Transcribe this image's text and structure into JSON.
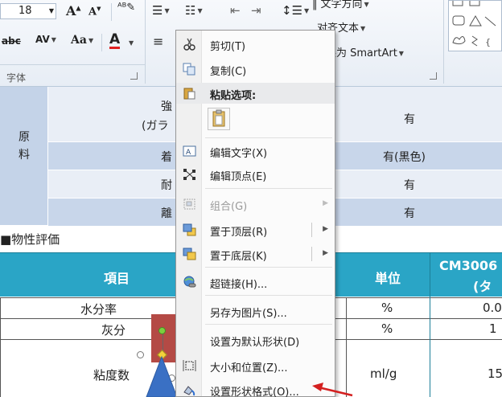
{
  "ribbon": {
    "font_size": "18",
    "group_font_label": "字体",
    "text_direction_label": "文字方向",
    "align_text_label": "对齐文本",
    "convert_smartart_label": "转换为 SmartArt"
  },
  "table1": {
    "row_header": [
      "原",
      "料"
    ],
    "rows": [
      {
        "item": "強",
        "item2": "(ガラ",
        "value": "有"
      },
      {
        "item": "着",
        "value": "有(黒色)"
      },
      {
        "item": "耐",
        "value": "有"
      },
      {
        "item": "離",
        "value": "有"
      }
    ]
  },
  "section_heading": "■物性評価",
  "table2": {
    "headers": {
      "item": "項目",
      "unit": "単位",
      "product": "CM3006",
      "product2": "(タ"
    },
    "rows": [
      {
        "item": "水分率",
        "unit": "%",
        "value": "0.0"
      },
      {
        "item": "灰分",
        "unit": "%",
        "value": "1"
      },
      {
        "item": "粘度数",
        "unit": "ml/g",
        "value": "15"
      }
    ]
  },
  "context_menu": {
    "items": [
      {
        "label": "剪切(T)",
        "icon": "scissors-icon"
      },
      {
        "label": "复制(C)",
        "icon": "copy-icon"
      },
      {
        "label": "粘贴选项:",
        "icon": "paste-icon"
      },
      {
        "label": "编辑文字(X)",
        "icon": "edit-text-icon"
      },
      {
        "label": "编辑顶点(E)",
        "icon": "edit-points-icon"
      },
      {
        "label": "组合(G)",
        "icon": "group-icon"
      },
      {
        "label": "置于顶层(R)",
        "icon": "bring-to-front-icon"
      },
      {
        "label": "置于底层(K)",
        "icon": "send-to-back-icon"
      },
      {
        "label": "超链接(H)...",
        "icon": "hyperlink-icon"
      },
      {
        "label": "另存为图片(S)...",
        "icon": ""
      },
      {
        "label": "设置为默认形状(D)",
        "icon": ""
      },
      {
        "label": "大小和位置(Z)...",
        "icon": "size-position-icon"
      },
      {
        "label": "设置形状格式(O)...",
        "icon": "format-shape-icon"
      }
    ]
  },
  "colors": {
    "table_header": "#2aa5c6",
    "table1_band": "#c4d3e8",
    "arrow": "#d42020"
  }
}
